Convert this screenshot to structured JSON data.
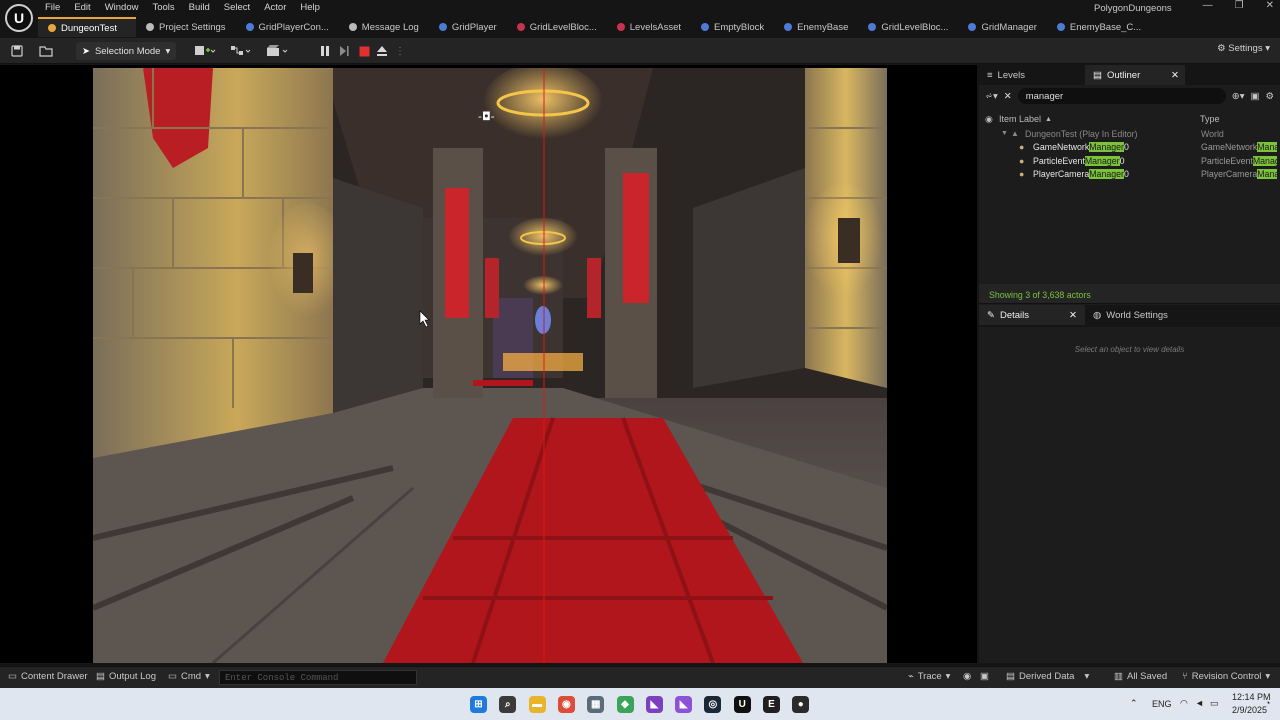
{
  "app": {
    "project_name": "PolygonDungeons",
    "menu": [
      "File",
      "Edit",
      "Window",
      "Tools",
      "Build",
      "Select",
      "Actor",
      "Help"
    ]
  },
  "tabs": [
    {
      "label": "DungeonTest",
      "color": "#e8a53c"
    },
    {
      "label": "Project Settings",
      "color": "#bbbbbb"
    },
    {
      "label": "GridPlayerCon...",
      "color": "#4f7bd8"
    },
    {
      "label": "Message Log",
      "color": "#bbbbbb"
    },
    {
      "label": "GridPlayer",
      "color": "#4f7bd8"
    },
    {
      "label": "GridLevelBloc...",
      "color": "#c8324f"
    },
    {
      "label": "LevelsAsset",
      "color": "#c8324f"
    },
    {
      "label": "EmptyBlock",
      "color": "#4f7bd8"
    },
    {
      "label": "EnemyBase",
      "color": "#4f7bd8"
    },
    {
      "label": "GridLevelBloc...",
      "color": "#4f7bd8"
    },
    {
      "label": "GridManager",
      "color": "#4f7bd8"
    },
    {
      "label": "EnemyBase_C...",
      "color": "#4f7bd8"
    }
  ],
  "toolbar": {
    "selection_mode": "Selection Mode",
    "settings": "Settings"
  },
  "outliner": {
    "tab_levels": "Levels",
    "tab_outliner": "Outliner",
    "search_value": "manager",
    "col_item_label": "Item Label",
    "col_type": "Type",
    "world_row": {
      "label": "DungeonTest (Play In Editor)",
      "type": "World"
    },
    "rows": [
      {
        "pre": "GameNetwork",
        "match": "Manager",
        "post": "0",
        "type_pre": "GameNetwork",
        "type_match": "Mana"
      },
      {
        "pre": "ParticleEvent",
        "match": "Manager",
        "post": "0",
        "type_pre": "ParticleEvent",
        "type_match": "Manag"
      },
      {
        "pre": "PlayerCamera",
        "match": "Manager",
        "post": "0",
        "type_pre": "PlayerCamera",
        "type_match": "Mana"
      }
    ],
    "status": "Showing 3 of 3,638 actors"
  },
  "details": {
    "tab_details": "Details",
    "tab_world_settings": "World Settings",
    "hint": "Select an object to view details"
  },
  "bottombar": {
    "content_drawer": "Content Drawer",
    "output_log": "Output Log",
    "cmd": "Cmd",
    "console_placeholder": "Enter Console Command",
    "trace": "Trace",
    "derived_data": "Derived Data",
    "all_saved": "All Saved",
    "revision_control": "Revision Control"
  },
  "taskbar": {
    "lang": "ENG",
    "time": "12:14 PM",
    "date": "2/9/2025",
    "apps": [
      {
        "name": "windows-start-icon",
        "color": "#1f7ae0",
        "glyph": "⊞"
      },
      {
        "name": "search-icon",
        "color": "#3a3a3a",
        "glyph": "⌕"
      },
      {
        "name": "file-explorer-icon",
        "color": "#e9b42c",
        "glyph": "▬"
      },
      {
        "name": "chrome-icon",
        "color": "#dd4b39",
        "glyph": "◉"
      },
      {
        "name": "calculator-icon",
        "color": "#5a6b7a",
        "glyph": "▦"
      },
      {
        "name": "app-green-icon",
        "color": "#3aa55a",
        "glyph": "◆"
      },
      {
        "name": "visual-studio-icon",
        "color": "#7b3fc0",
        "glyph": "◣"
      },
      {
        "name": "visual-studio-alt-icon",
        "color": "#8e52d6",
        "glyph": "◣"
      },
      {
        "name": "steam-icon",
        "color": "#1b2838",
        "glyph": "◎"
      },
      {
        "name": "unreal-engine-icon",
        "color": "#101010",
        "glyph": "U"
      },
      {
        "name": "epic-games-icon",
        "color": "#202020",
        "glyph": "E"
      },
      {
        "name": "obs-icon",
        "color": "#2a2a2a",
        "glyph": "●"
      }
    ]
  }
}
